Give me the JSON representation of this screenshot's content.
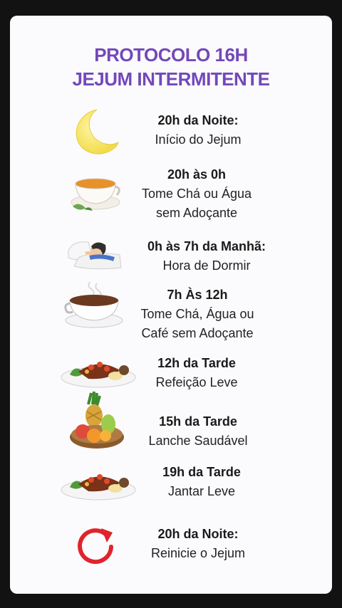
{
  "title": {
    "line1": "PROTOCOLO 16H",
    "line2": "JEJUM INTERMITENTE"
  },
  "items": [
    {
      "time": "20h da Noite:",
      "desc": "Início do Jejum",
      "icon": "moon-icon"
    },
    {
      "time": "20h às 0h",
      "desc": "Tome Chá ou Água\nsem Adoçante",
      "icon": "tea-cup-icon"
    },
    {
      "time": "0h às 7h da Manhã:",
      "desc": "Hora de Dormir",
      "icon": "sleeping-person-icon"
    },
    {
      "time": "7h Às 12h",
      "desc": "Tome Chá, Água ou\nCafé sem Adoçante",
      "icon": "coffee-cup-icon"
    },
    {
      "time": "12h da Tarde",
      "desc": "Refeição Leve",
      "icon": "meal-plate-icon"
    },
    {
      "time": "15h da Tarde",
      "desc": "Lanche Saudável",
      "icon": "fruit-bowl-icon"
    },
    {
      "time": "19h da Tarde",
      "desc": "Jantar Leve",
      "icon": "dinner-plate-icon"
    },
    {
      "time": "20h da Noite:",
      "desc": "Reinicie o Jejum",
      "icon": "restart-arrow-icon"
    }
  ],
  "colors": {
    "title": "#7348b9",
    "restart_icon": "#e0242b",
    "moon": "#f6e56b"
  }
}
